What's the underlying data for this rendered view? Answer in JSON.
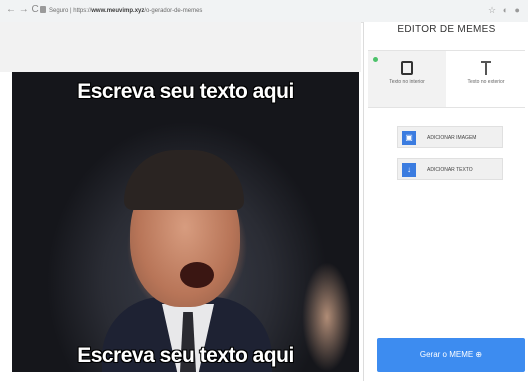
{
  "browser": {
    "nav_icons": "← → C",
    "url_prefix": "Seguro | https://",
    "url_host": "www.meuvimp.xyz",
    "url_rest": "/o-gerador-de-memes",
    "tab_icons": "☆ ◐ ●"
  },
  "meme": {
    "top_text": "Escreva seu texto aqui",
    "bottom_text": "Escreva seu texto aqui"
  },
  "panel": {
    "title": "EDITOR DE MEMES",
    "mode_tabs": [
      {
        "label": "Texto no interior",
        "icon": "phone-frame-icon",
        "active": true
      },
      {
        "label": "Texto no exterior",
        "icon": "text-cursor-icon",
        "active": false
      }
    ],
    "actions": [
      {
        "label": "ADICIONAR IMAGEM",
        "icon": "image-icon"
      },
      {
        "label": "ADICIONAR TEXTO",
        "icon": "download-icon"
      }
    ],
    "generate_label": "Gerar o MEME ⊕"
  },
  "colors": {
    "accent": "#3d8cf0",
    "active_dot": "#4cc26a"
  }
}
